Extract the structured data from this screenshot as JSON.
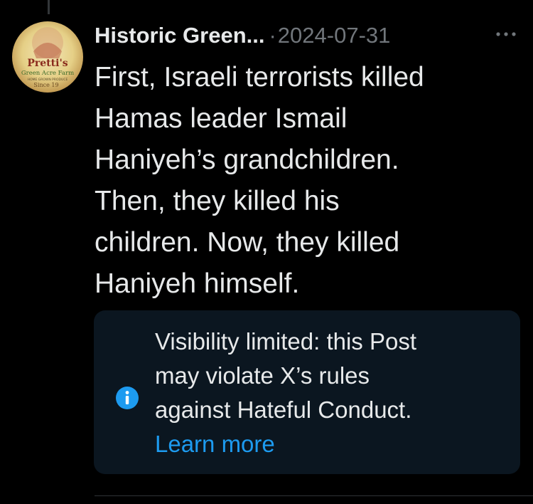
{
  "post": {
    "author_name": "Historic Green...",
    "separator": "·",
    "date": "2024-07-31",
    "text": "First, Israeli terrorists killed\nHamas leader Ismail\nHaniyeh’s grandchildren.\nThen, they killed his\nchildren. Now, they killed\nHaniyeh himself.",
    "avatar": {
      "logo_line1": "Pretti's",
      "logo_line2": "Green Acre Farm",
      "logo_line3": "HOME GROWN PRODUCE",
      "logo_line4": "Since 19"
    },
    "more_icon": "more-horizontal-icon"
  },
  "notice": {
    "icon": "info-icon",
    "message": "Visibility limited: this Post\nmay violate X’s rules\nagainst Hateful Conduct.",
    "link_label": "Learn more"
  },
  "colors": {
    "background": "#000000",
    "text_primary": "#e7e9ea",
    "text_secondary": "#71767b",
    "accent": "#1d9bf0",
    "notice_bg": "#0b1620"
  }
}
